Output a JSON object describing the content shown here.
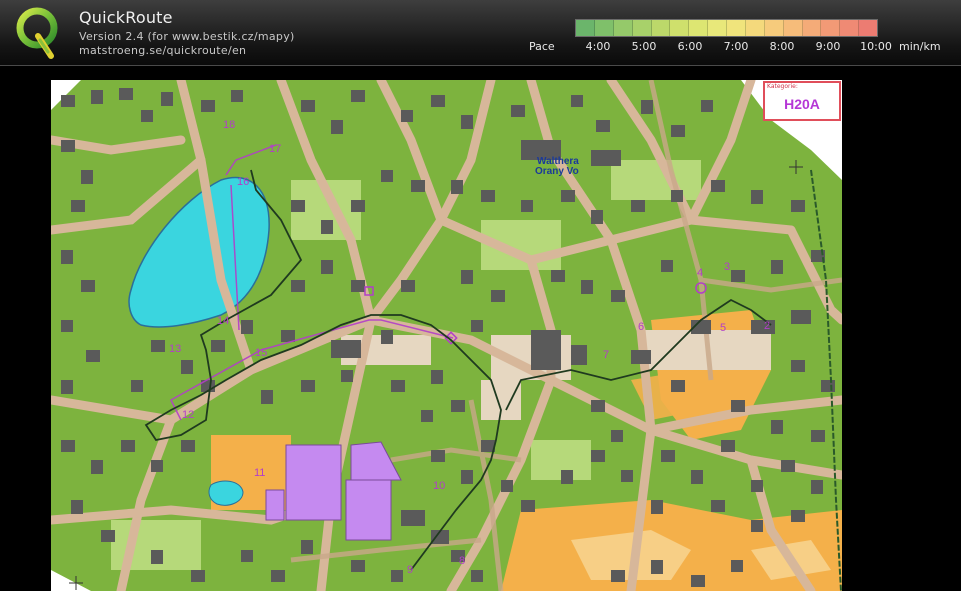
{
  "app": {
    "title": "QuickRoute",
    "version": "Version 2.4  (for www.bestik.cz/mapy)",
    "website": "matstroeng.se/quickroute/en"
  },
  "pace": {
    "label": "Pace",
    "ticks": [
      "4:00",
      "5:00",
      "6:00",
      "7:00",
      "8:00",
      "9:00",
      "10:00"
    ],
    "unit": "min/km",
    "gradient_colors": [
      "#6bb56b",
      "#7fc06a",
      "#95c96a",
      "#a8d16a",
      "#bcd86a",
      "#cfe06c",
      "#dde672",
      "#e8e87a",
      "#f0e47c",
      "#f4d97c",
      "#f6cb7c",
      "#f6bc7a",
      "#f4ab78",
      "#f29a76",
      "#ef8a74",
      "#ec7c72"
    ]
  },
  "map": {
    "category_label": "Kategorie:",
    "category_value": "H20A",
    "street_label_1": "Walthera",
    "street_label_2": "Orany Vo",
    "control_numbers": [
      "18",
      "17",
      "16",
      "14",
      "13",
      "15",
      "12",
      "11",
      "10",
      "9",
      "8",
      "7",
      "6",
      "5",
      "4",
      "3",
      "2"
    ]
  },
  "colors": {
    "forest_green": "#7db33e",
    "light_green": "#b6d97a",
    "building": "#5a5a5a",
    "road": "#d7b79a",
    "lake": "#3ad5df",
    "open_land": "#f4b04a",
    "control_purple": "#b23ec9"
  }
}
